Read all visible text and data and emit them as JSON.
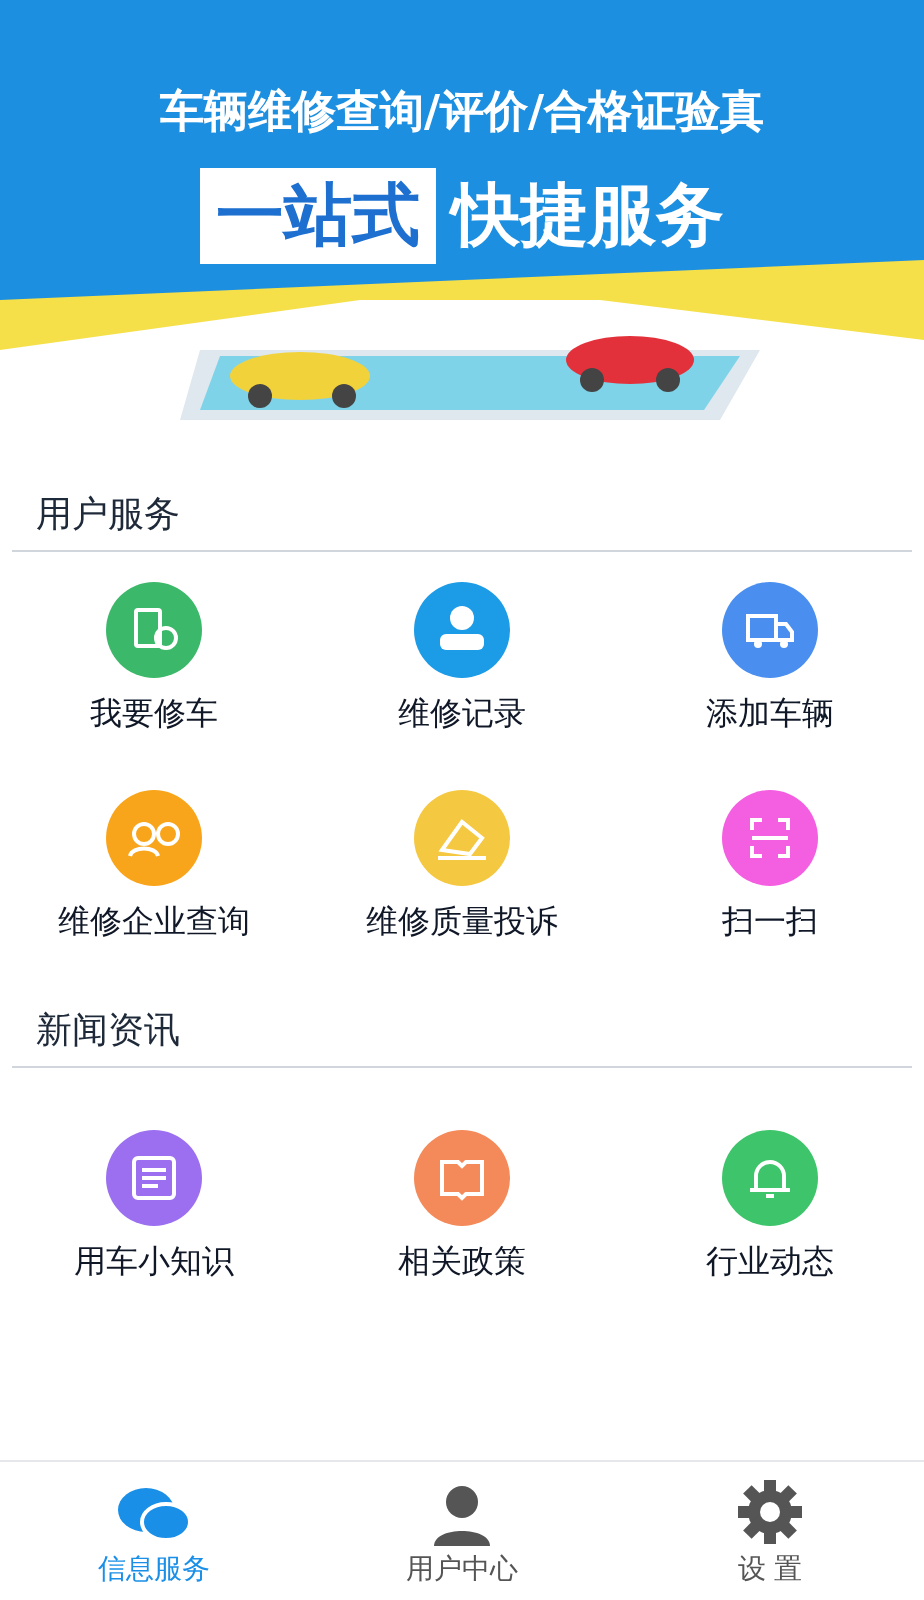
{
  "banner": {
    "subtitle": "车辆维修查询/评价/合格证验真",
    "title_left": "一站式",
    "title_right": "快捷服务"
  },
  "sections": [
    {
      "title": "用户服务",
      "items": [
        {
          "label": "我要修车",
          "color": "#3cb86a"
        },
        {
          "label": "维修记录",
          "color": "#1c9be6"
        },
        {
          "label": "添加车辆",
          "color": "#4a8ff0"
        },
        {
          "label": "维修企业查询",
          "color": "#f9a51c"
        },
        {
          "label": "维修质量投诉",
          "color": "#f5c842"
        },
        {
          "label": "扫一扫",
          "color": "#f45ee0"
        }
      ]
    },
    {
      "title": "新闻资讯",
      "items": [
        {
          "label": "用车小知识",
          "color": "#9b6ff0"
        },
        {
          "label": "相关政策",
          "color": "#f48a5a"
        },
        {
          "label": "行业动态",
          "color": "#3ec46a"
        }
      ]
    }
  ],
  "tabs": [
    {
      "label": "信息服务",
      "selected": true
    },
    {
      "label": "用户中心",
      "selected": false
    },
    {
      "label": "设 置",
      "selected": false
    }
  ]
}
